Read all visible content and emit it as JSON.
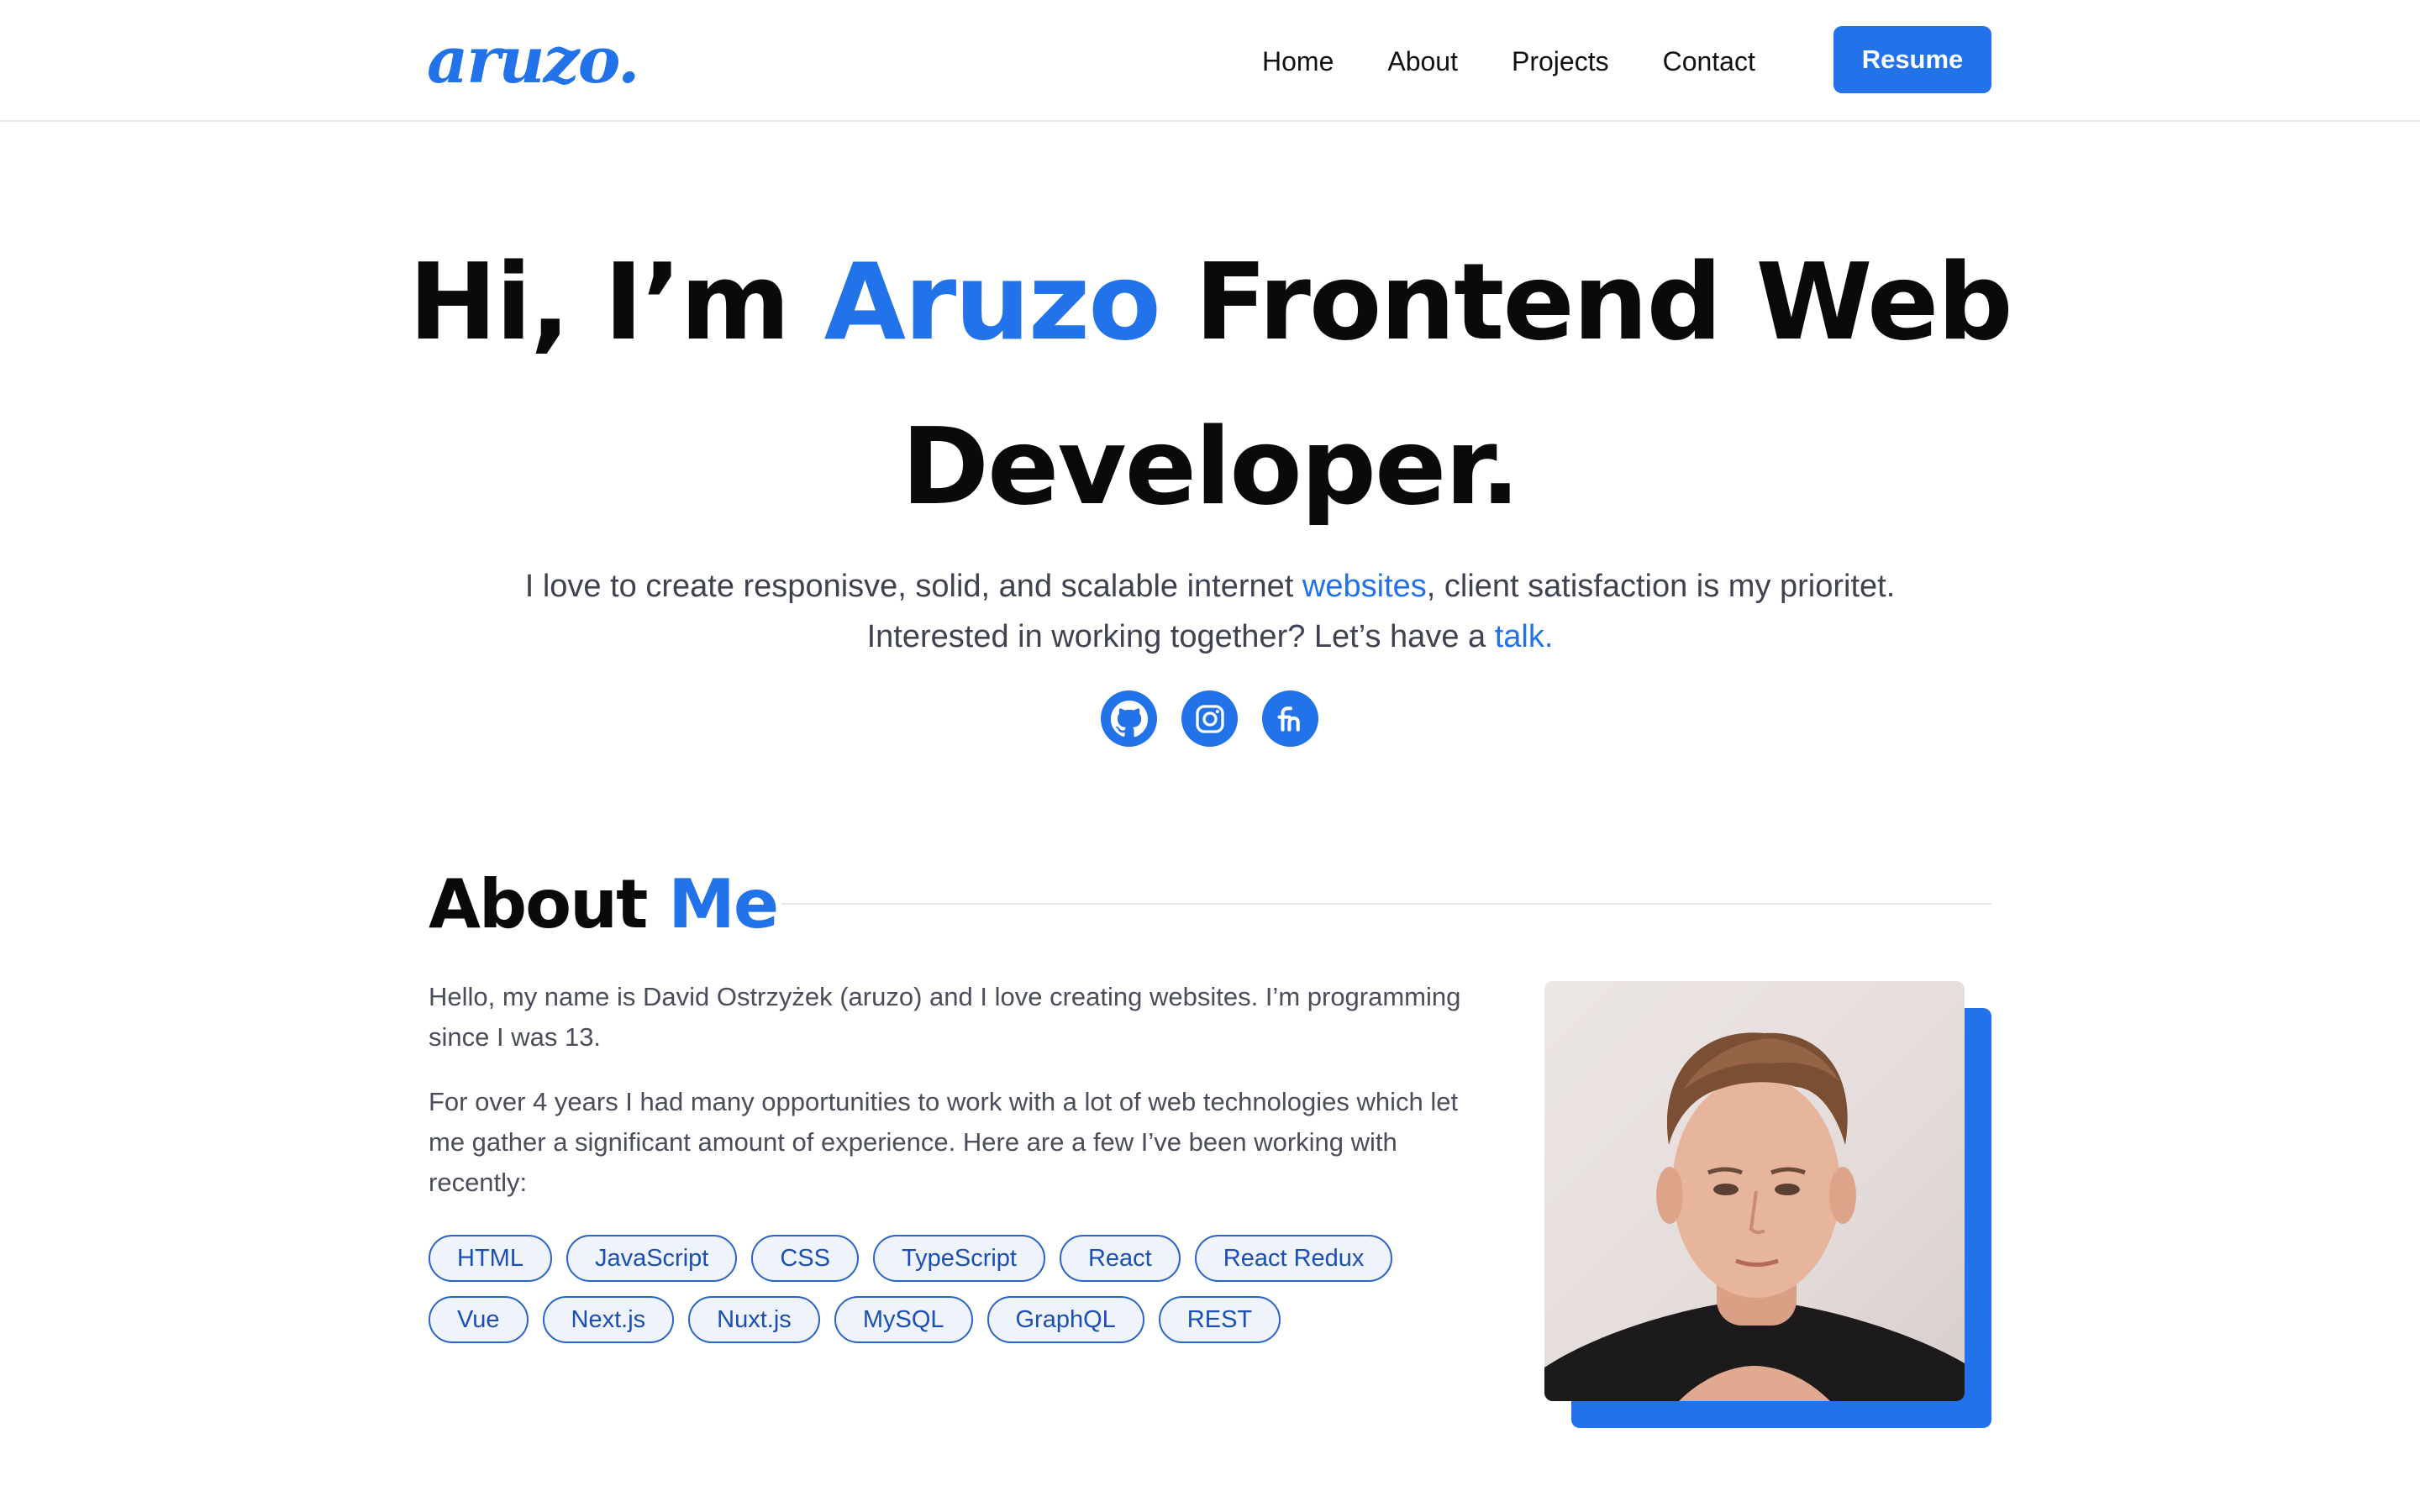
{
  "header": {
    "logo": "aruzo.",
    "nav": [
      "Home",
      "About",
      "Projects",
      "Contact"
    ],
    "resume_label": "Resume"
  },
  "hero": {
    "title_pre": "Hi, I’m ",
    "title_name": "Aruzo",
    "title_post": " Frontend Web Developer.",
    "line1_pre": "I love to create responisve, solid, and scalable internet ",
    "line1_link": "websites",
    "line1_post": ", client satisfaction is my prioritet.",
    "line2_pre": "Interested in working together? Let’s have a ",
    "line2_link": "talk."
  },
  "socials": {
    "icons": [
      "github-icon",
      "instagram-icon",
      "frontend-mentor-icon"
    ]
  },
  "about": {
    "title_a": "About",
    "title_b": "Me",
    "p1": "Hello, my name is David Ostrzyżek (aruzo) and I love creating websites. I’m programming since I was 13.",
    "p2": "For over 4 years I had many opportunities to work with a lot of web technologies which let me gather a significant amount of experience. Here are a few I’ve been working with recently:",
    "tags_row1": [
      "HTML",
      "JavaScript",
      "CSS",
      "TypeScript",
      "React",
      "React Redux"
    ],
    "tags_row2": [
      "Vue",
      "Next.js",
      "Nuxt.js",
      "MySQL",
      "GraphQL",
      "REST"
    ]
  },
  "colors": {
    "accent": "#2272ea",
    "text": "#0a0a0a",
    "muted": "#4a4d5a",
    "tag_border": "#2a63c9",
    "tag_bg": "#eef3fc"
  }
}
